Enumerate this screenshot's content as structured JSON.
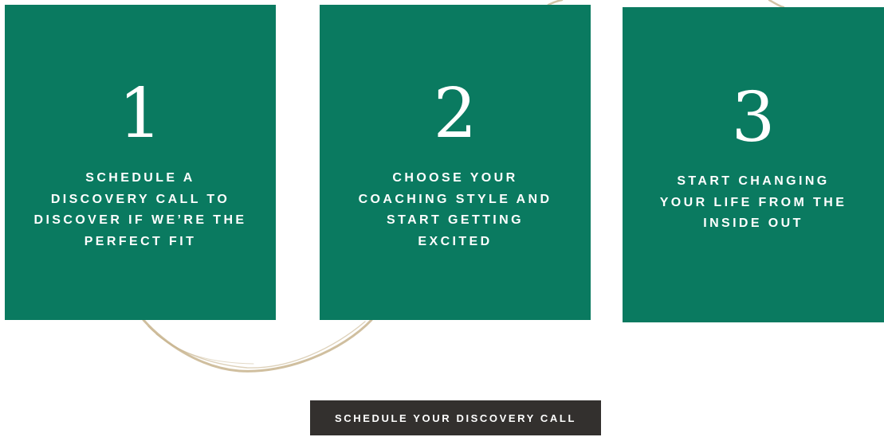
{
  "colors": {
    "card_green": "#0a7a60",
    "button_dark": "#33302e",
    "swirl_gold": "#c8b48e"
  },
  "steps": [
    {
      "number": "1",
      "text": "SCHEDULE A\nDISCOVERY CALL TO\nDISCOVER IF WE’RE THE\nPERFECT FIT"
    },
    {
      "number": "2",
      "text": "CHOOSE YOUR\nCOACHING STYLE AND\nSTART GETTING\nEXCITED"
    },
    {
      "number": "3",
      "text": "START CHANGING\nYOUR LIFE FROM THE\nINSIDE OUT"
    }
  ],
  "cta": {
    "label": "SCHEDULE YOUR DISCOVERY CALL"
  }
}
